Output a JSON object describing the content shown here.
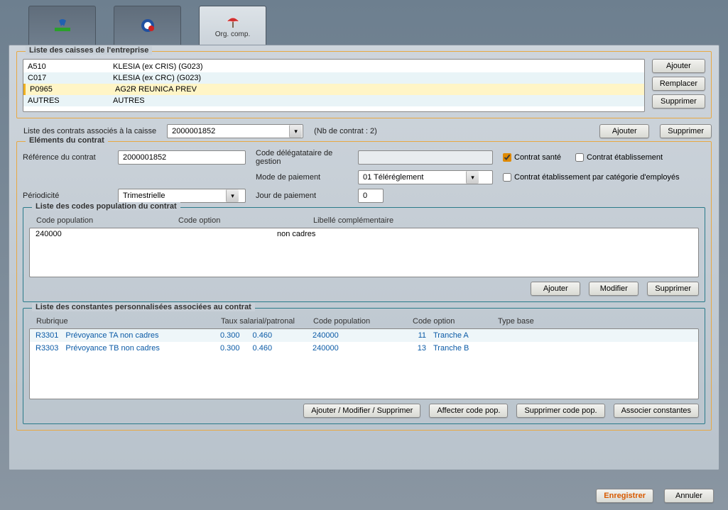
{
  "tabs": {
    "active_label": "Org. comp."
  },
  "caisses": {
    "legend": "Liste des caisses de l'entreprise",
    "items": [
      {
        "code": "A510",
        "name": "KLESIA (ex CRIS)  (G023)"
      },
      {
        "code": "C017",
        "name": "KLESIA (ex CRC)  (G023)"
      },
      {
        "code": "P0965",
        "name": "AG2R REUNICA PREV"
      },
      {
        "code": "AUTRES",
        "name": "AUTRES"
      }
    ],
    "btns": {
      "add": "Ajouter",
      "replace": "Remplacer",
      "delete": "Supprimer"
    }
  },
  "contracts": {
    "label": "Liste des contrats associés à la caisse",
    "selected": "2000001852",
    "count_label": "(Nb de contrat : 2)",
    "add": "Ajouter",
    "delete": "Supprimer"
  },
  "elements": {
    "legend": "Eléments du contrat",
    "ref_label": "Référence du contrat",
    "ref_value": "2000001852",
    "deleg_label": "Code délégatataire de gestion",
    "deleg_value": "",
    "sante_label": "Contrat santé",
    "etab_label": "Contrat établissement",
    "mode_label": "Mode de paiement",
    "mode_value": "01 Téléréglement",
    "cat_label": "Contrat établissement par catégorie d'employés",
    "period_label": "Périodicité",
    "period_value": "Trimestrielle",
    "jour_label": "Jour de paiement",
    "jour_value": "0"
  },
  "populations": {
    "legend": "Liste des codes population du contrat",
    "headers": {
      "h1": "Code population",
      "h2": "Code option",
      "h3": "Libellé complémentaire"
    },
    "rows": [
      {
        "code": "240000",
        "option": "",
        "libelle": "non cadres"
      }
    ],
    "btns": {
      "add": "Ajouter",
      "modify": "Modifier",
      "delete": "Supprimer"
    }
  },
  "constants": {
    "legend": "Liste des constantes personnalisées associées au contrat",
    "headers": {
      "rub": "Rubrique",
      "tx": "Taux salarial/patronal",
      "cp": "Code population",
      "co": "Code option",
      "tb": "Type base"
    },
    "rows": [
      {
        "rub_code": "R3301",
        "rub_name": "Prévoyance TA non cadres",
        "tx_s": "0.300",
        "tx_p": "0.460",
        "cp": "240000",
        "co": "11",
        "tb": "Tranche A"
      },
      {
        "rub_code": "R3303",
        "rub_name": "Prévoyance TB non cadres",
        "tx_s": "0.300",
        "tx_p": "0.460",
        "cp": "240000",
        "co": "13",
        "tb": "Tranche B"
      }
    ],
    "btns": {
      "manage": "Ajouter / Modifier / Supprimer",
      "affect": "Affecter code pop.",
      "suppr": "Supprimer code pop.",
      "assoc": "Associer constantes"
    }
  },
  "footer": {
    "save": "Enregistrer",
    "cancel": "Annuler"
  }
}
